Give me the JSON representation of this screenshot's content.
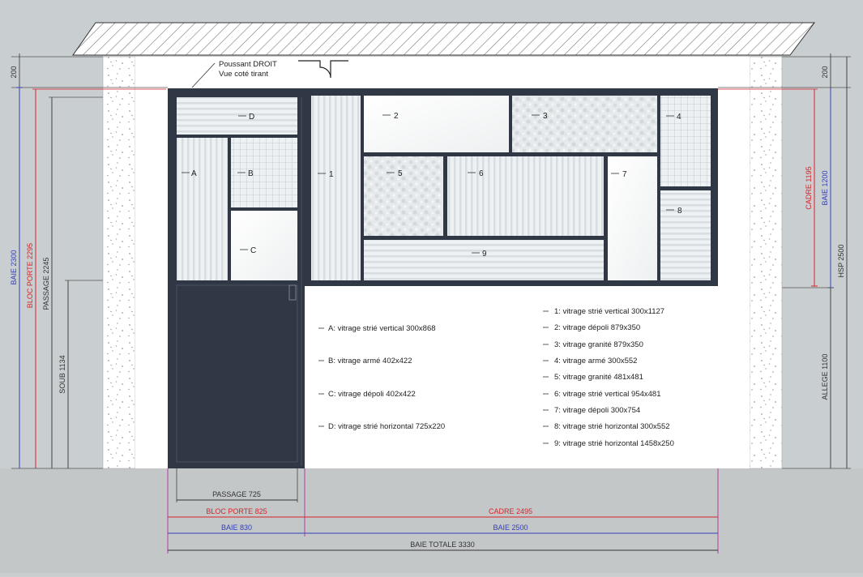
{
  "annotation": {
    "line1": "Poussant DROIT",
    "line2": "Vue coté tirant"
  },
  "panes": {
    "A": "A",
    "B": "B",
    "C": "C",
    "D": "D",
    "p1": "1",
    "p2": "2",
    "p3": "3",
    "p4": "4",
    "p5": "5",
    "p6": "6",
    "p7": "7",
    "p8": "8",
    "p9": "9"
  },
  "legend_left": [
    "A: vitrage strié vertical 300x868",
    "B: vitrage armé 402x422",
    "C: vitrage dépoli 402x422",
    "D: vitrage strié horizontal 725x220"
  ],
  "legend_right": [
    "1: vitrage strié vertical 300x1127",
    "2: vitrage dépoli 879x350",
    "3: vitrage granité 879x350",
    "4: vitrage armé 300x552",
    "5: vitrage granité 481x481",
    "6: vitrage strié vertical 954x481",
    "7: vitrage dépoli 300x754",
    "8: vitrage strié horizontal 300x552",
    "9: vitrage strié horizontal 1458x250"
  ],
  "dimensions_left": {
    "top_200": "200",
    "baie": "BAIE 2300",
    "bloc_porte": "BLOC PORTE 2295",
    "passage": "PASSAGE 2245",
    "soub": "SOUB 1134"
  },
  "dimensions_right": {
    "top_200": "200",
    "cadre": "CADRE 1195",
    "baie": "BAIE 1200",
    "hsp": "HSP 2500",
    "allege": "ALLEGE 1100"
  },
  "dimensions_bottom": {
    "passage": "PASSAGE 725",
    "bloc_porte": "BLOC PORTE 825",
    "cadre": "CADRE 2495",
    "baie_left": "BAIE 830",
    "baie_right": "BAIE 2500",
    "baie_totale": "BAIE TOTALE 3330"
  },
  "colors": {
    "background": "#c9ced1",
    "wall": "#ffffff",
    "frame": "#303845",
    "dim_black": "#333333",
    "dim_red": "#d8232a",
    "dim_blue": "#3340b8",
    "dim_magenta": "#b0309a"
  }
}
